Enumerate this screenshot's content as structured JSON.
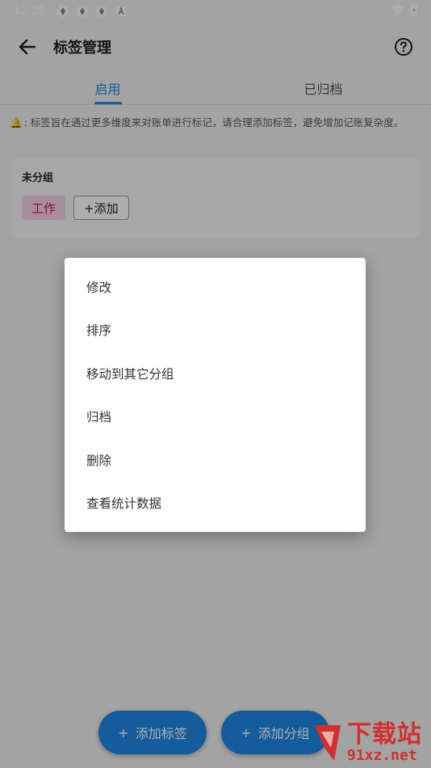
{
  "status_bar": {
    "time": "12:28",
    "icons": [
      "sync-icon",
      "sync-icon",
      "sync-icon",
      "a-icon",
      "wifi-icon",
      "battery-icon"
    ]
  },
  "app_bar": {
    "title": "标签管理"
  },
  "tabs": [
    {
      "label": "启用",
      "active": true
    },
    {
      "label": "已归档",
      "active": false
    }
  ],
  "notice": {
    "text": ": 标签旨在通过更多维度来对账单进行标记，请合理添加标签，避免增加记账复杂度。"
  },
  "group": {
    "name": "未分组",
    "tags": [
      "工作"
    ],
    "add_label": "+添加"
  },
  "context_menu": {
    "items": [
      "修改",
      "排序",
      "移动到其它分组",
      "归档",
      "删除",
      "查看统计数据"
    ]
  },
  "fabs": {
    "add_tag": "添加标签",
    "add_group": "添加分组"
  },
  "watermark": {
    "cn": "下载站",
    "en": "91xz.net"
  },
  "colors": {
    "accent": "#1e88e5",
    "tag_bg": "#f8d2e8",
    "tag_text": "#c2185b",
    "watermark": "#d32f2f"
  }
}
